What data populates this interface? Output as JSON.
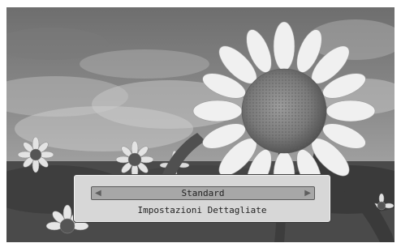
{
  "picture_mode": {
    "selected_value": "Standard",
    "left_icon": "triangle-left-icon",
    "right_icon": "triangle-right-icon"
  },
  "menu": {
    "detailed_settings_label": "Impostazioni Dettagliate"
  },
  "colors": {
    "panel": "#d7d7d7",
    "selector": "#a7a7a7",
    "text": "#1f1f1f"
  }
}
